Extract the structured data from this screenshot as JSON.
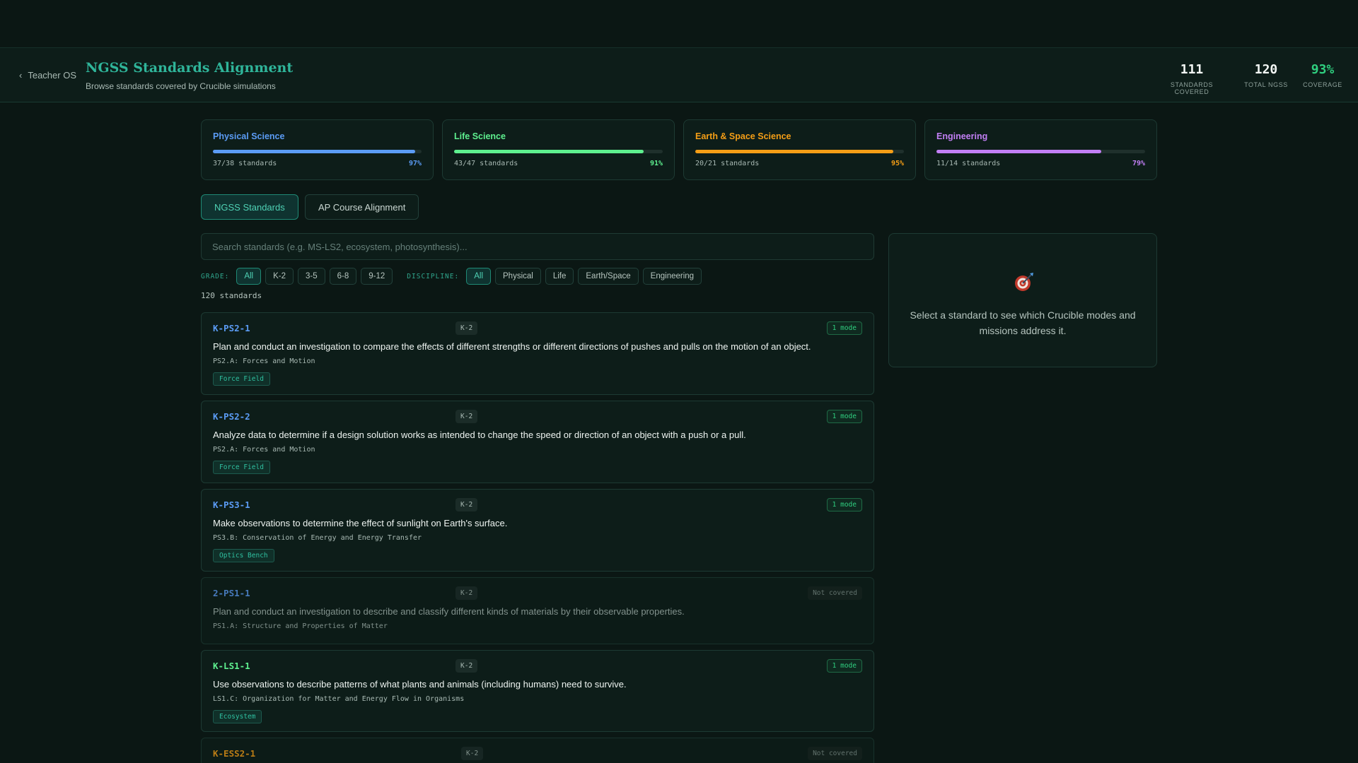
{
  "header": {
    "back_label": "Teacher OS",
    "title": "NGSS Standards Alignment",
    "subtitle": "Browse standards covered by Crucible simulations",
    "stats": [
      {
        "value": "111",
        "label": "STANDARDS COVERED"
      },
      {
        "value": "120",
        "label": "TOTAL NGSS"
      },
      {
        "value": "93%",
        "label": "COVERAGE"
      }
    ]
  },
  "disciplines": [
    {
      "name": "Physical Science",
      "count": "37/38 standards",
      "pct": "97%",
      "fraction": 0.97,
      "color": "#5b9cf5"
    },
    {
      "name": "Life Science",
      "count": "43/47 standards",
      "pct": "91%",
      "fraction": 0.91,
      "color": "#5ef08f"
    },
    {
      "name": "Earth & Space Science",
      "count": "20/21 standards",
      "pct": "95%",
      "fraction": 0.95,
      "color": "#f59e16"
    },
    {
      "name": "Engineering",
      "count": "11/14 standards",
      "pct": "79%",
      "fraction": 0.79,
      "color": "#c27ff5"
    }
  ],
  "tabs": [
    {
      "label": "NGSS Standards"
    },
    {
      "label": "AP Course Alignment"
    }
  ],
  "search": {
    "placeholder": "Search standards (e.g. MS-LS2, ecosystem, photosynthesis)..."
  },
  "filters": {
    "grade_label": "GRADE:",
    "grades": [
      "All",
      "K-2",
      "3-5",
      "6-8",
      "9-12"
    ],
    "discipline_label": "DISCIPLINE:",
    "disciplines": [
      "All",
      "Physical",
      "Life",
      "Earth/Space",
      "Engineering"
    ]
  },
  "count_text": "120 standards",
  "standards": [
    {
      "code": "K-PS2-1",
      "grade": "K-2",
      "badge": "1 mode",
      "description": "Plan and conduct an investigation to compare the effects of different strengths or different directions of pushes and pulls on the motion of an object.",
      "dci": "PS2.A: Forces and Motion",
      "tag": "Force Field"
    },
    {
      "code": "K-PS2-2",
      "grade": "K-2",
      "badge": "1 mode",
      "description": "Analyze data to determine if a design solution works as intended to change the speed or direction of an object with a push or a pull.",
      "dci": "PS2.A: Forces and Motion",
      "tag": "Force Field"
    },
    {
      "code": "K-PS3-1",
      "grade": "K-2",
      "badge": "1 mode",
      "description": "Make observations to determine the effect of sunlight on Earth's surface.",
      "dci": "PS3.B: Conservation of Energy and Energy Transfer",
      "tag": "Optics Bench"
    },
    {
      "code": "2-PS1-1",
      "grade": "K-2",
      "badge": "Not covered",
      "description": "Plan and conduct an investigation to describe and classify different kinds of materials by their observable properties.",
      "dci": "PS1.A: Structure and Properties of Matter"
    },
    {
      "code": "K-LS1-1",
      "grade": "K-2",
      "badge": "1 mode",
      "description": "Use observations to describe patterns of what plants and animals (including humans) need to survive.",
      "dci": "LS1.C: Organization for Matter and Energy Flow in Organisms",
      "tag": "Ecosystem"
    },
    {
      "code": "K-ESS2-1",
      "grade": "K-2",
      "badge": "Not covered"
    }
  ],
  "panel": {
    "text": "Select a standard to see which Crucible modes and missions address it."
  }
}
